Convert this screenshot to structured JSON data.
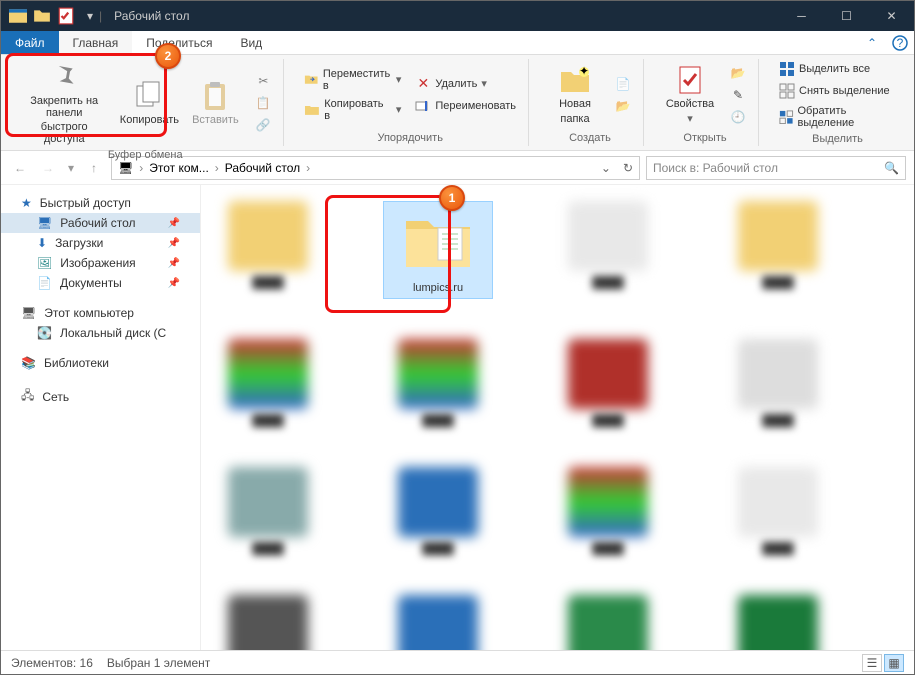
{
  "window_title": "Рабочий стол",
  "tabs": {
    "file": "Файл",
    "home": "Главная",
    "share": "Поделиться",
    "view": "Вид"
  },
  "ribbon": {
    "pin_label_l1": "Закрепить на панели",
    "pin_label_l2": "быстрого доступа",
    "copy": "Копировать",
    "paste": "Вставить",
    "group_clipboard": "Буфер обмена",
    "move_to": "Переместить в",
    "copy_to": "Копировать в",
    "delete": "Удалить",
    "rename": "Переименовать",
    "group_organize": "Упорядочить",
    "new_folder_l1": "Новая",
    "new_folder_l2": "папка",
    "group_create": "Создать",
    "properties": "Свойства",
    "group_open": "Открыть",
    "select_all": "Выделить все",
    "select_none": "Снять выделение",
    "invert_sel": "Обратить выделение",
    "group_select": "Выделить"
  },
  "breadcrumb": {
    "root": "Этот ком...",
    "current": "Рабочий стол"
  },
  "search_placeholder": "Поиск в: Рабочий стол",
  "sidebar": {
    "quick_access": "Быстрый доступ",
    "desktop": "Рабочий стол",
    "downloads": "Загрузки",
    "pictures": "Изображения",
    "documents": "Документы",
    "this_pc": "Этот компьютер",
    "local_disk": "Локальный диск (C",
    "libraries": "Библиотеки",
    "network": "Сеть"
  },
  "selected_item": "lumpics.ru",
  "status": {
    "count_label": "Элементов:",
    "count": "16",
    "selected": "Выбран 1 элемент"
  },
  "callouts": {
    "one": "1",
    "two": "2"
  },
  "blur_items": [
    {
      "c": "#f2d074"
    },
    {
      "c": "#e8e8e8"
    },
    {
      "c": "#f2d074"
    },
    {
      "c": "linear-gradient(#c33,#3c3,#36c)"
    },
    {
      "c": "linear-gradient(#c33,#3c3,#36c)"
    },
    {
      "c": "#b0302a"
    },
    {
      "c": "#ddd"
    },
    {
      "c": "#8aa"
    },
    {
      "c": "#2a6fb8"
    },
    {
      "c": "linear-gradient(#c33,#3c3,#36c)"
    },
    {
      "c": "#e8e8e8"
    },
    {
      "c": "#555"
    },
    {
      "c": "#2a6fb8"
    },
    {
      "c": "#2a8a4a"
    },
    {
      "c": "#1a7a3a"
    }
  ]
}
